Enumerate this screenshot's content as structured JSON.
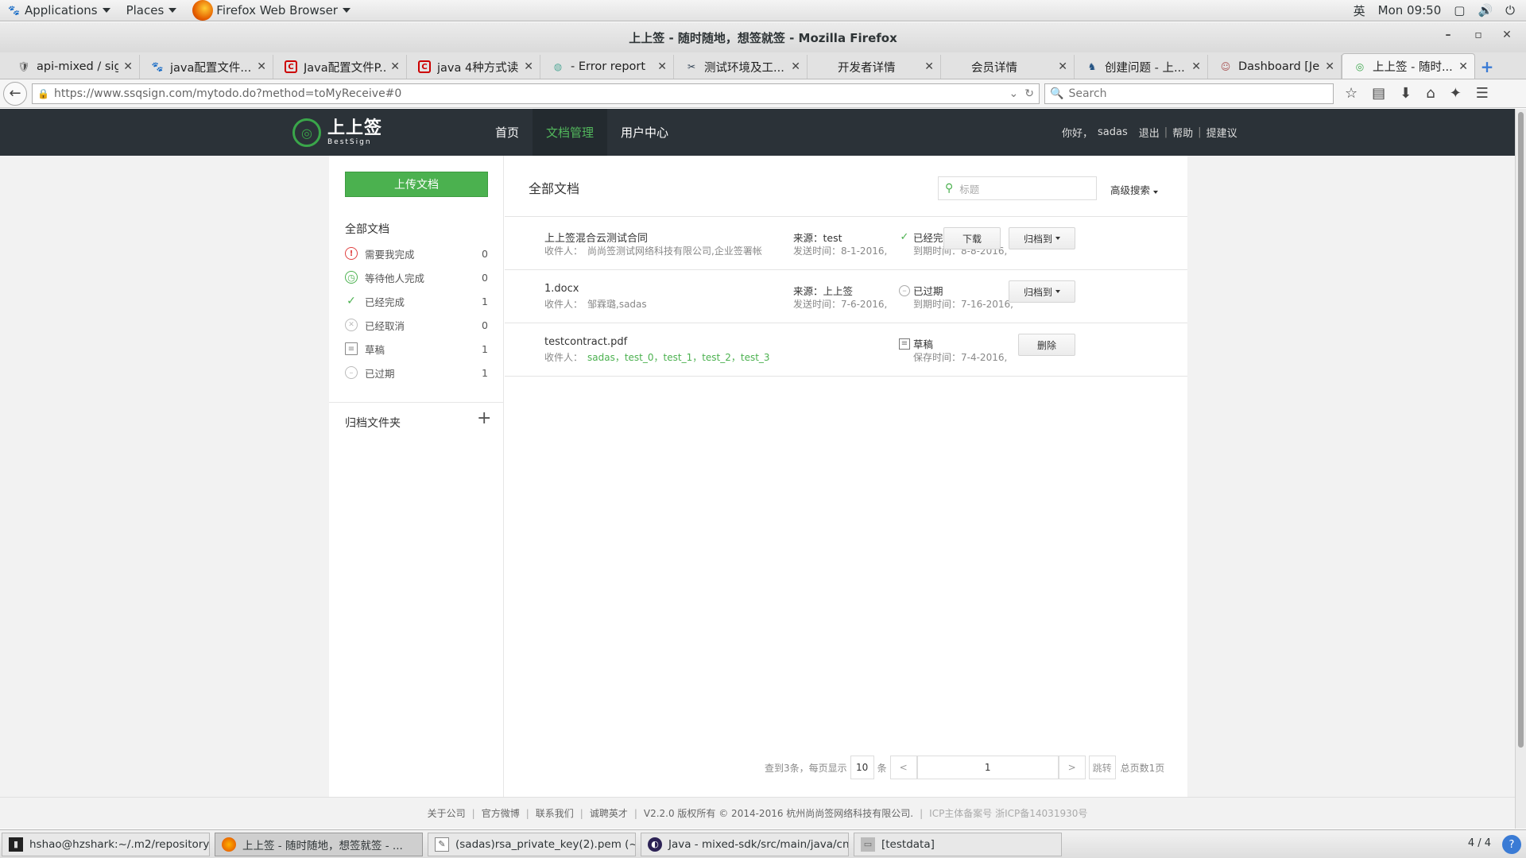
{
  "gnome_panel": {
    "applications": "Applications",
    "places": "Places",
    "active_app": "Firefox Web Browser",
    "input_method": "英",
    "clock": "Mon 09:50"
  },
  "window": {
    "title": "上上签 - 随时随地，想签就签 - Mozilla Firefox"
  },
  "tabs": [
    {
      "label": "api-mixed / sig...",
      "icon": "bitbucket-icon"
    },
    {
      "label": "java配置文件...",
      "icon": "baidu-icon"
    },
    {
      "label": "Java配置文件P...",
      "icon": "csdn-icon"
    },
    {
      "label": "java 4种方式读...",
      "icon": "csdn-icon"
    },
    {
      "label": "- Error report",
      "icon": "globe-icon"
    },
    {
      "label": "测试环境及工...",
      "icon": "tools-icon"
    },
    {
      "label": "开发者详情",
      "icon": ""
    },
    {
      "label": "会员详情",
      "icon": ""
    },
    {
      "label": "创建问题 - 上...",
      "icon": "jira-icon"
    },
    {
      "label": "Dashboard [Je...",
      "icon": "jenkins-icon"
    },
    {
      "label": "上上签 - 随时...",
      "icon": "bestsign-icon",
      "active": true
    }
  ],
  "nav": {
    "url": "https://www.ssqsign.com/mytodo.do?method=toMyReceive#0",
    "search_placeholder": "Search"
  },
  "site": {
    "logo_cn": "上上签",
    "logo_en": "BestSign",
    "menu": [
      {
        "label": "首页"
      },
      {
        "label": "文档管理",
        "active": true
      },
      {
        "label": "用户中心"
      }
    ],
    "greeting": "你好，",
    "username": "sadas",
    "logout": "退出",
    "help": "帮助",
    "feedback": "提建议"
  },
  "sidebar": {
    "upload_button": "上传文档",
    "all_docs": "全部文档",
    "items": [
      {
        "label": "需要我完成",
        "count": "0",
        "icon": "alert-icon"
      },
      {
        "label": "等待他人完成",
        "count": "0",
        "icon": "clock-icon"
      },
      {
        "label": "已经完成",
        "count": "1",
        "icon": "check-icon"
      },
      {
        "label": "已经取消",
        "count": "0",
        "icon": "cancel-icon"
      },
      {
        "label": "草稿",
        "count": "1",
        "icon": "draft-icon"
      },
      {
        "label": "已过期",
        "count": "1",
        "icon": "expired-icon"
      }
    ],
    "archive_folder": "归档文件夹",
    "add_symbol": "+"
  },
  "main": {
    "title": "全部文档",
    "search_placeholder": "标题",
    "advanced_search": "高级搜索",
    "documents": [
      {
        "name": "上上签混合云测试合同",
        "recipients_label": "收件人：",
        "recipients": "尚尚签测试网络科技有限公司,企业签署帐",
        "source": "来源：test",
        "sent": "发送时间：8-1-2016,",
        "status": "已经完成",
        "status_icon": "check-icon",
        "due": "到期时间：8-8-2016,",
        "actions": [
          "下载",
          "归档到"
        ]
      },
      {
        "name": "1.docx",
        "recipients_label": "收件人：",
        "recipients": "邹霖璐,sadas",
        "source": "来源：上上签",
        "sent": "发送时间：7-6-2016,",
        "status": "已过期",
        "status_icon": "expired-icon",
        "due": "到期时间：7-16-2016,",
        "actions": [
          "归档到"
        ]
      },
      {
        "name": "testcontract.pdf",
        "recipients_label": "收件人：",
        "recipients": "sadas，test_0，test_1，test_2，test_3",
        "source": "",
        "sent": "",
        "status": "草稿",
        "status_icon": "draft-icon",
        "due": "保存时间：7-4-2016,",
        "actions": [
          "删除"
        ]
      }
    ],
    "pager": {
      "found_text": "查到3条，每页显示",
      "per_page": "10",
      "unit": "条",
      "prev": "<",
      "page": "1",
      "next": ">",
      "jump": "跳转",
      "total_pages": "总页数1页"
    }
  },
  "footer": {
    "links": [
      "关于公司",
      "官方微博",
      "联系我们",
      "诚聘英才"
    ],
    "copyright": "V2.2.0 版权所有 © 2014-2016 杭州尚尚签网络科技有限公司.",
    "icp": "ICP主体备案号 浙ICP备14031930号"
  },
  "taskbar": {
    "items": [
      {
        "label": "hshao@hzshark:~/.m2/repository/...",
        "icon": "terminal-icon"
      },
      {
        "label": "上上签 - 随时随地，想签就签 - ...",
        "icon": "firefox-icon",
        "active": true
      },
      {
        "label": "(sadas)rsa_private_key(2).pem (~/...",
        "icon": "text-editor-icon"
      },
      {
        "label": "Java - mixed-sdk/src/main/java/cn...",
        "icon": "eclipse-icon"
      },
      {
        "label": "[testdata]",
        "icon": "folder-icon"
      }
    ],
    "workspace": "4 / 4"
  },
  "colors": {
    "brand_green": "#4bb14f",
    "header_dark": "#2b3238",
    "page_bg": "#f2f2f2"
  }
}
